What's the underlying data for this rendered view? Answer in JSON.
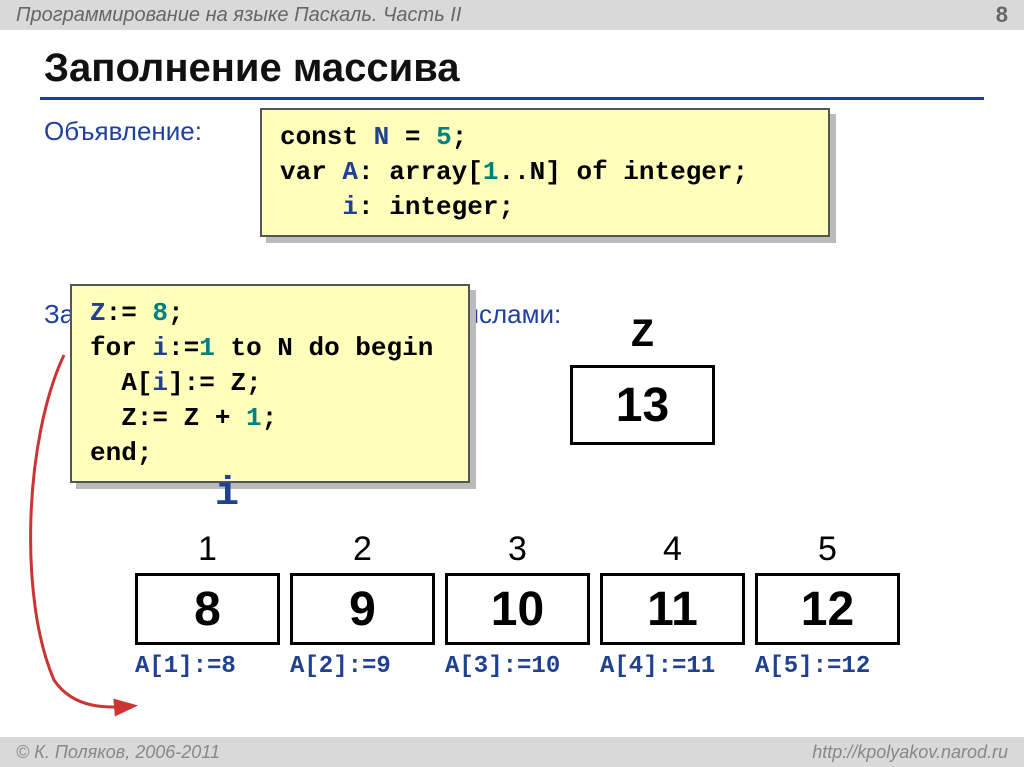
{
  "header": {
    "title": "Программирование на языке Паскаль. Часть II",
    "page": "8"
  },
  "slide_title": "Заполнение массива",
  "section1": {
    "label": "Объявление:"
  },
  "code1": {
    "l1a": "const",
    "l1b": "N",
    "l1c": "= ",
    "l1d": "5",
    "l1e": ";",
    "l2a": "var",
    "l2b": "A",
    "l2c": ": array[",
    "l2d": "1",
    "l2e": "..N] of integer;",
    "l3a": "    ",
    "l3b": "i",
    "l3c": ": integer;"
  },
  "section2": {
    "label": "Заполнение последовательными числами:"
  },
  "code2": {
    "l1a": "Z",
    "l1b": ":= ",
    "l1c": "8",
    "l1d": ";",
    "l2a": "for",
    "l2b": "i",
    "l2c": ":=",
    "l2d": "1",
    "l2e": " to N do begin",
    "l3a": "  A[",
    "l3b": "i",
    "l3c": "]:= Z;",
    "l4a": "  Z:= Z + ",
    "l4b": "1",
    "l4c": ";",
    "l5": "end;"
  },
  "z": {
    "label": "Z",
    "value": "13"
  },
  "i_label": "i",
  "array": {
    "indices": [
      "1",
      "2",
      "3",
      "4",
      "5"
    ],
    "values": [
      "8",
      "9",
      "10",
      "11",
      "12"
    ],
    "assigns": [
      "A[1]:=8",
      "A[2]:=9",
      "A[3]:=10",
      "A[4]:=11",
      "A[5]:=12"
    ]
  },
  "footer": {
    "left": "© К. Поляков, 2006-2011",
    "right": "http://kpolyakov.narod.ru"
  }
}
